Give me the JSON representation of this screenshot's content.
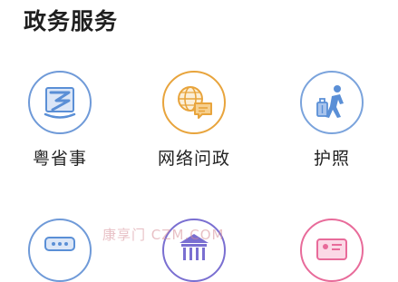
{
  "section": {
    "title": "政务服务"
  },
  "services": [
    {
      "label": "粤省事",
      "icon": "yue-shengshi-icon",
      "color": "#5a8fd6"
    },
    {
      "label": "网络问政",
      "icon": "globe-chat-icon",
      "color": "#e8a43c"
    },
    {
      "label": "护照",
      "icon": "traveler-luggage-icon",
      "color": "#5a8fd6"
    }
  ],
  "partial_services": [
    {
      "icon": "chat-bubble-icon",
      "color": "#5a8fd6"
    },
    {
      "icon": "government-building-icon",
      "color": "#7a6fd1"
    },
    {
      "icon": "id-card-icon",
      "color": "#e86b9a"
    }
  ],
  "watermark": "康享门  CZM.COM"
}
